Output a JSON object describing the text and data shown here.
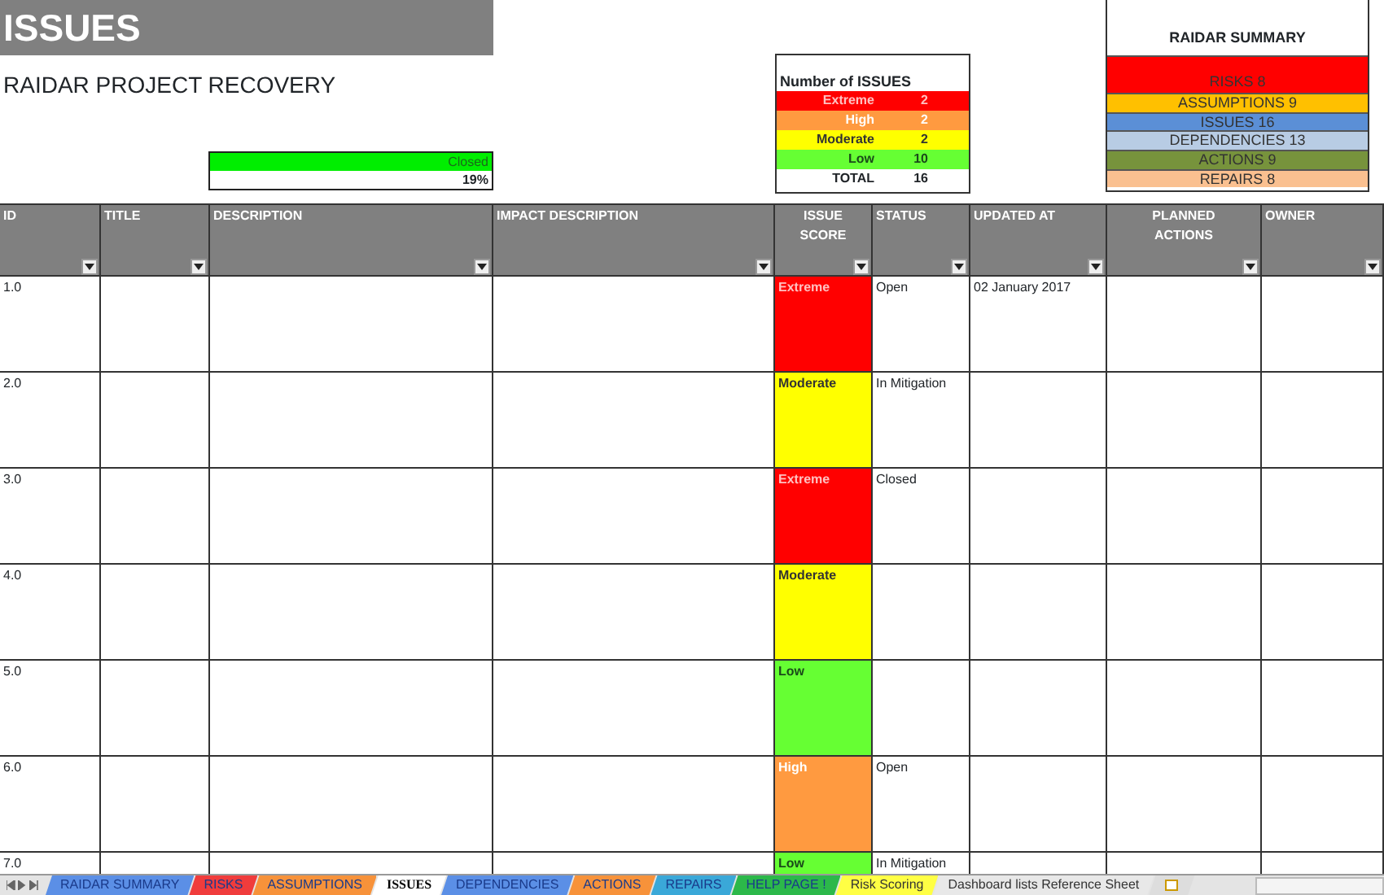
{
  "sheet_title": "ISSUES",
  "project": "RAIDAR PROJECT RECOVERY",
  "closed_meter": {
    "label": "Closed",
    "value": "19%"
  },
  "issue_counts": {
    "title": "Number of ISSUES",
    "rows": [
      {
        "label": "Extreme",
        "count": "2",
        "kind": "extreme"
      },
      {
        "label": "High",
        "count": "2",
        "kind": "high"
      },
      {
        "label": "Moderate",
        "count": "2",
        "kind": "moderate"
      },
      {
        "label": "Low",
        "count": "10",
        "kind": "low"
      }
    ],
    "total_label": "TOTAL",
    "total": "16"
  },
  "summary": {
    "title": "RAIDAR SUMMARY",
    "items": [
      {
        "label": "RISKS 8",
        "color": "#ff0000"
      },
      {
        "label": "ASSUMPTIONS 9",
        "color": "#ffc000"
      },
      {
        "label": "ISSUES 16",
        "color": "#5b8fd6"
      },
      {
        "label": "DEPENDENCIES 13",
        "color": "#b8cce4"
      },
      {
        "label": "ACTIONS 9",
        "color": "#77933c"
      },
      {
        "label": "REPAIRS 8",
        "color": "#fac090"
      }
    ]
  },
  "table": {
    "columns": [
      "ID",
      "TITLE",
      "DESCRIPTION",
      "IMPACT DESCRIPTION",
      "ISSUE SCORE",
      "STATUS",
      "UPDATED AT",
      "PLANNED ACTIONS",
      "OWNER"
    ],
    "rows": [
      {
        "id": "1.0",
        "score": "Extreme",
        "kind": "extreme",
        "status": "Open",
        "updated": "02 January 2017"
      },
      {
        "id": "2.0",
        "score": "Moderate",
        "kind": "moderate",
        "status": "In Mitigation"
      },
      {
        "id": "3.0",
        "score": "Extreme",
        "kind": "extreme",
        "status": "Closed"
      },
      {
        "id": "4.0",
        "score": "Moderate",
        "kind": "moderate"
      },
      {
        "id": "5.0",
        "score": "Low",
        "kind": "low"
      },
      {
        "id": "6.0",
        "score": "High",
        "kind": "high",
        "status": "Open"
      },
      {
        "id": "7.0",
        "score": "Low",
        "kind": "low",
        "status": "In Mitigation"
      }
    ]
  },
  "sheet_tabs": [
    {
      "label": "RAIDAR SUMMARY",
      "color": "#5b8fe6",
      "selected": false
    },
    {
      "label": "RISKS",
      "color": "#f03c3c",
      "selected": false
    },
    {
      "label": "ASSUMPTIONS",
      "color": "#f7923a",
      "selected": false
    },
    {
      "label": "ISSUES",
      "color": "#ffffff",
      "selected": true
    },
    {
      "label": "DEPENDENCIES",
      "color": "#5b8fe6",
      "selected": false
    },
    {
      "label": "ACTIONS",
      "color": "#f7923a",
      "selected": false
    },
    {
      "label": "REPAIRS",
      "color": "#3aa8d8",
      "selected": false
    },
    {
      "label": "HELP PAGE !",
      "color": "#2cb84a",
      "selected": false
    },
    {
      "label": "Risk Scoring",
      "color": "#ffff44",
      "selected": false
    },
    {
      "label": "Dashboard lists Reference Sheet",
      "color": "#e8e8e8",
      "selected": false
    }
  ]
}
